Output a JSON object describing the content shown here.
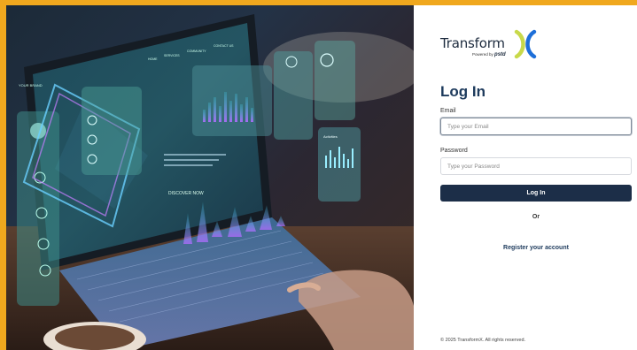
{
  "brand": {
    "name": "Transform",
    "powered_by": "Powered by",
    "partner": "pstd"
  },
  "hero_screen": {
    "brand": "YOUR BRAND",
    "nav": [
      "HOME",
      "SERVICES",
      "COMMUNITY",
      "CONTACT US"
    ],
    "discover": "DISCOVER NOW",
    "widget_title": "Activities"
  },
  "login": {
    "title": "Log In",
    "email_label": "Email",
    "email_placeholder": "Type your Email",
    "password_label": "Password",
    "password_placeholder": "Type your Password",
    "submit_label": "Log In",
    "or_label": "Or",
    "register_label": "Register your account"
  },
  "footer": {
    "copyright": "© 2025 TransformX. All rights reserved."
  },
  "colors": {
    "frame": "#f0a81e",
    "primary": "#1c2e48",
    "title": "#1d3a5c",
    "brand_blue": "#1e6fd9",
    "brand_lime": "#c8d94a"
  }
}
